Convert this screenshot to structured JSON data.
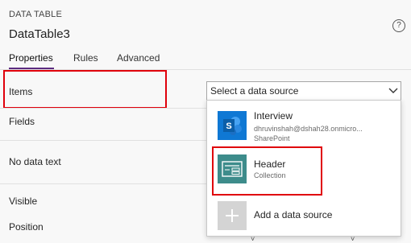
{
  "panel": {
    "type_label": "DATA TABLE",
    "control_name": "DataTable3",
    "help_glyph": "?"
  },
  "tabs": [
    {
      "label": "Properties",
      "active": true
    },
    {
      "label": "Rules",
      "active": false
    },
    {
      "label": "Advanced",
      "active": false
    }
  ],
  "properties": {
    "items_label": "Items",
    "fields_label": "Fields",
    "no_data_text_label": "No data text",
    "visible_label": "Visible",
    "position_label": "Position"
  },
  "data_source_select": {
    "placeholder": "Select a data source"
  },
  "data_sources": [
    {
      "name": "Interview",
      "detail": "dhruvinshah@dshah28.onmicro...",
      "type": "SharePoint",
      "icon": "sharepoint-icon",
      "color": "#0f78d4"
    },
    {
      "name": "Header",
      "detail": "",
      "type": "Collection",
      "icon": "collection-icon",
      "color": "#3d8c8b"
    }
  ],
  "add_source": {
    "label": "Add a data source",
    "icon": "plus-icon"
  },
  "colors": {
    "accent": "#5b2b80",
    "highlight": "#e0000b",
    "sharepoint": "#0f78d4",
    "collection": "#3d8c8b"
  }
}
